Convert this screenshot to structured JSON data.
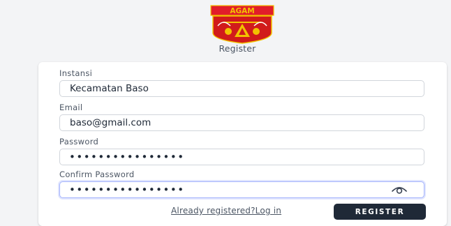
{
  "page": {
    "title": "Register"
  },
  "logo": {
    "text": "AGAM",
    "colors": {
      "border": "#c8102e",
      "ribbon": "#e11d2a",
      "shield": "#d11b1b",
      "accent": "#f2c200"
    }
  },
  "form": {
    "instansi": {
      "label": "Instansi",
      "value": "Kecamatan Baso"
    },
    "email": {
      "label": "Email",
      "value": "baso@gmail.com"
    },
    "password": {
      "label": "Password",
      "value": "••••••••••••••••"
    },
    "confirm_password": {
      "label": "Confirm Password",
      "value": "••••••••••••••••",
      "icon": "eye-icon"
    }
  },
  "actions": {
    "login_link": "Already registered?Log in",
    "register_button": "REGISTER"
  },
  "colors": {
    "background": "#f3f4f6",
    "button": "#1f2937",
    "focus": "#a5b4fc"
  }
}
